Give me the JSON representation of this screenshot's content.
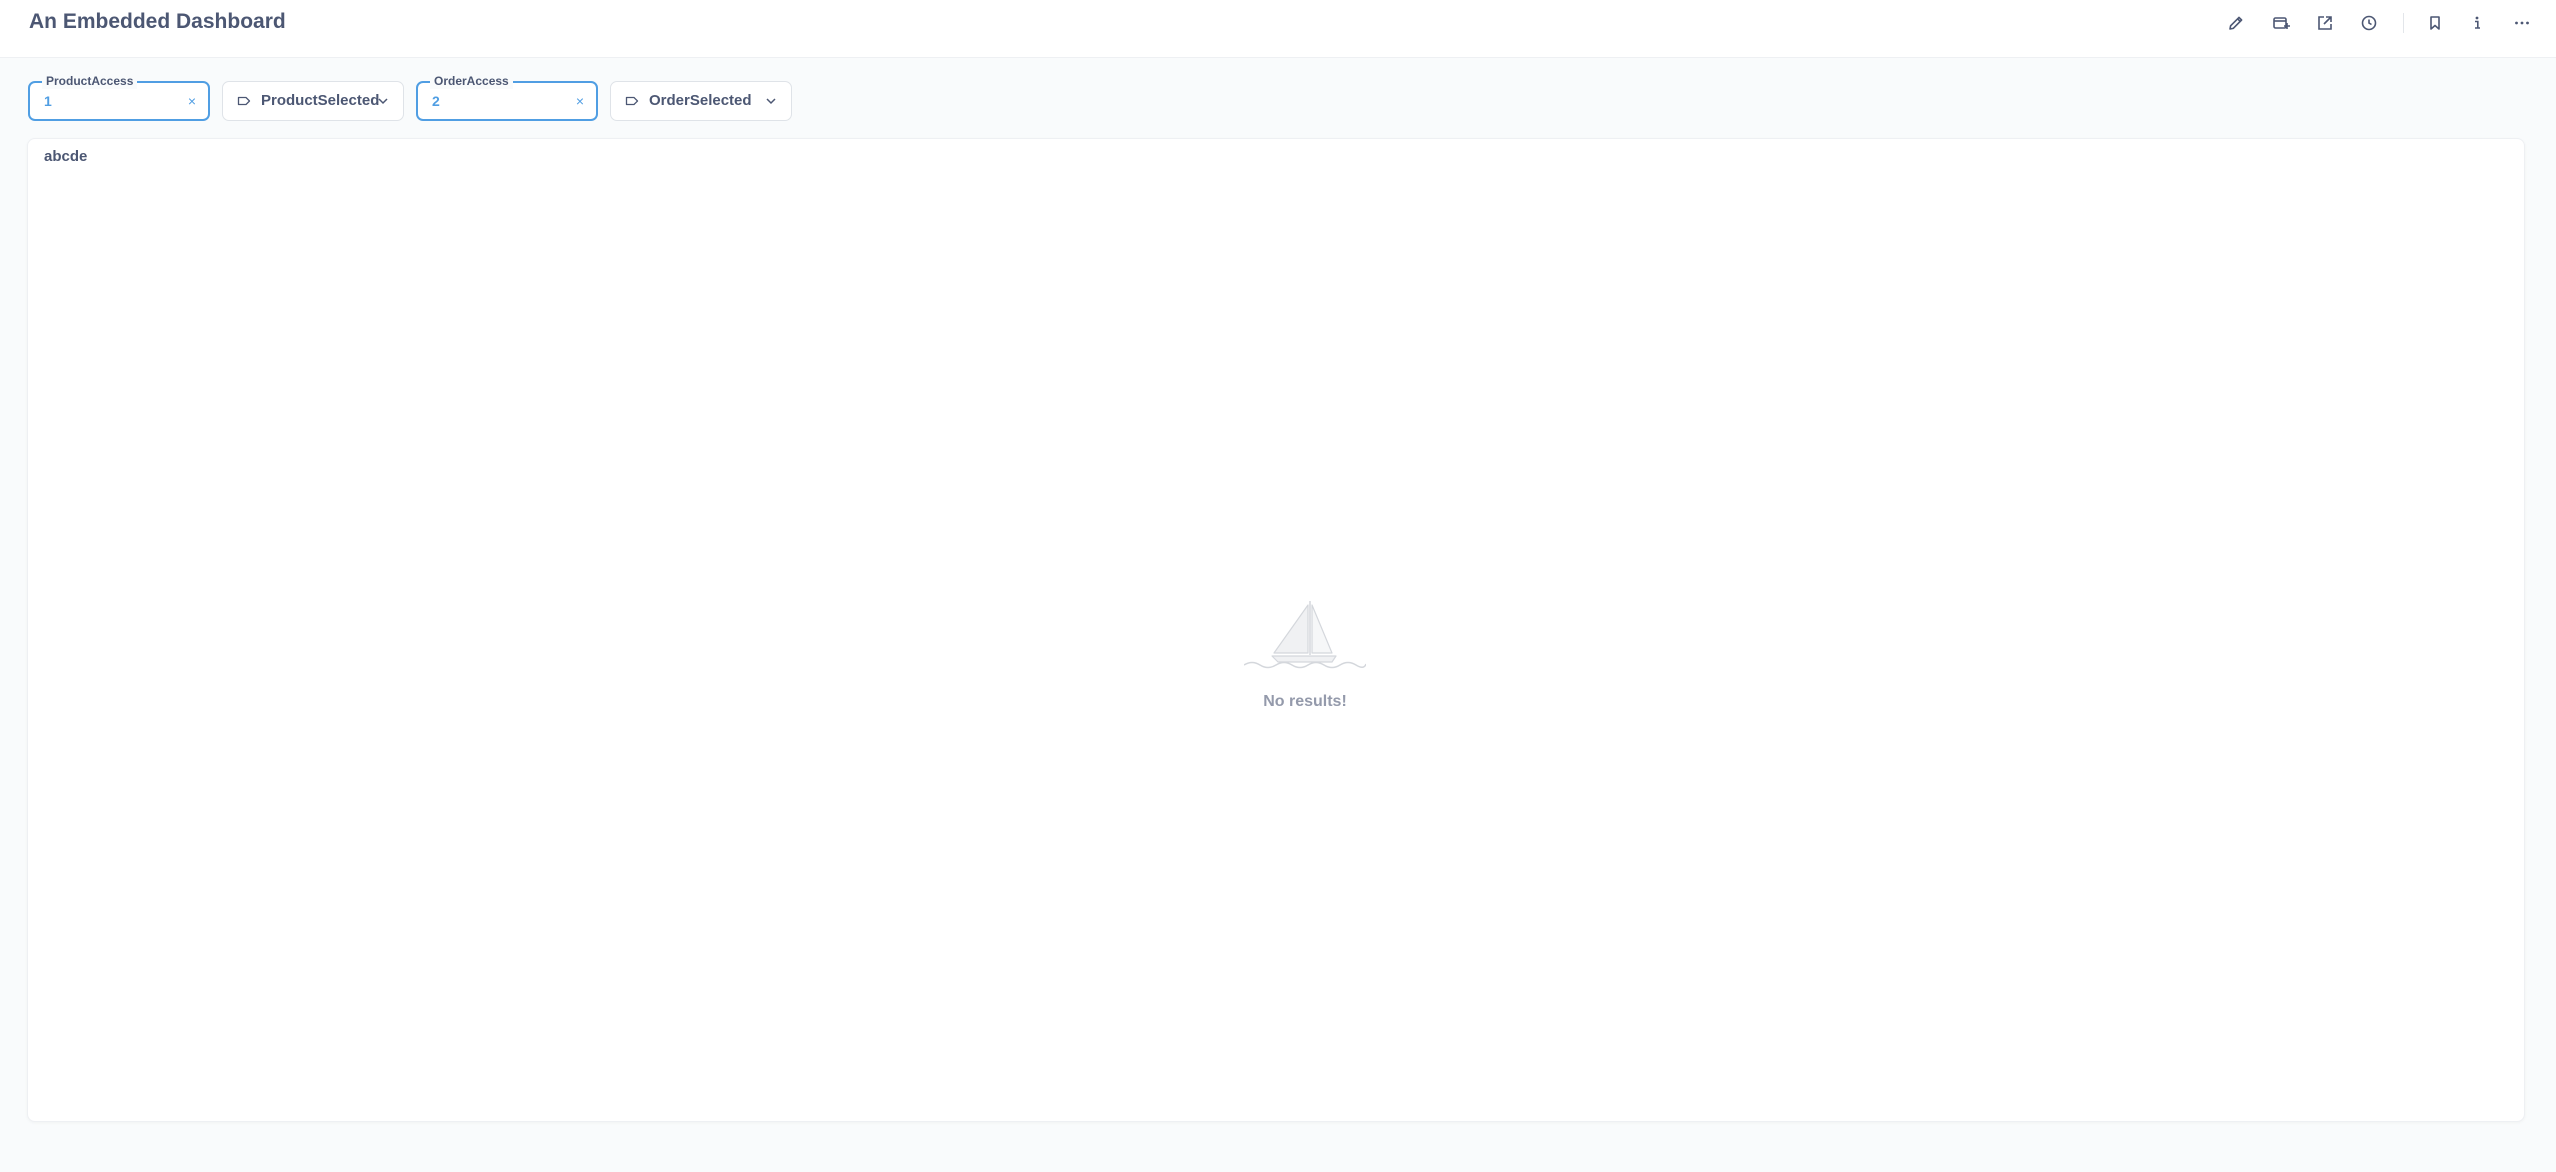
{
  "header": {
    "title": "An Embedded Dashboard",
    "actions": [
      "pencil-icon",
      "subscription-icon",
      "share-icon",
      "history-icon",
      "bookmark-icon",
      "info-icon",
      "more-icon"
    ]
  },
  "filters": [
    {
      "legend": "ProductAccess",
      "value": "1",
      "clear": "×"
    },
    {
      "label": "ProductSelected"
    },
    {
      "legend": "OrderAccess",
      "value": "2",
      "clear": "×"
    },
    {
      "label": "OrderSelected"
    }
  ],
  "card": {
    "title": "abcde",
    "empty_text": "No results!"
  },
  "colors": {
    "accent": "#509ee3",
    "text": "#4c5773",
    "muted": "#949aab",
    "background": "#f9fbfc"
  }
}
